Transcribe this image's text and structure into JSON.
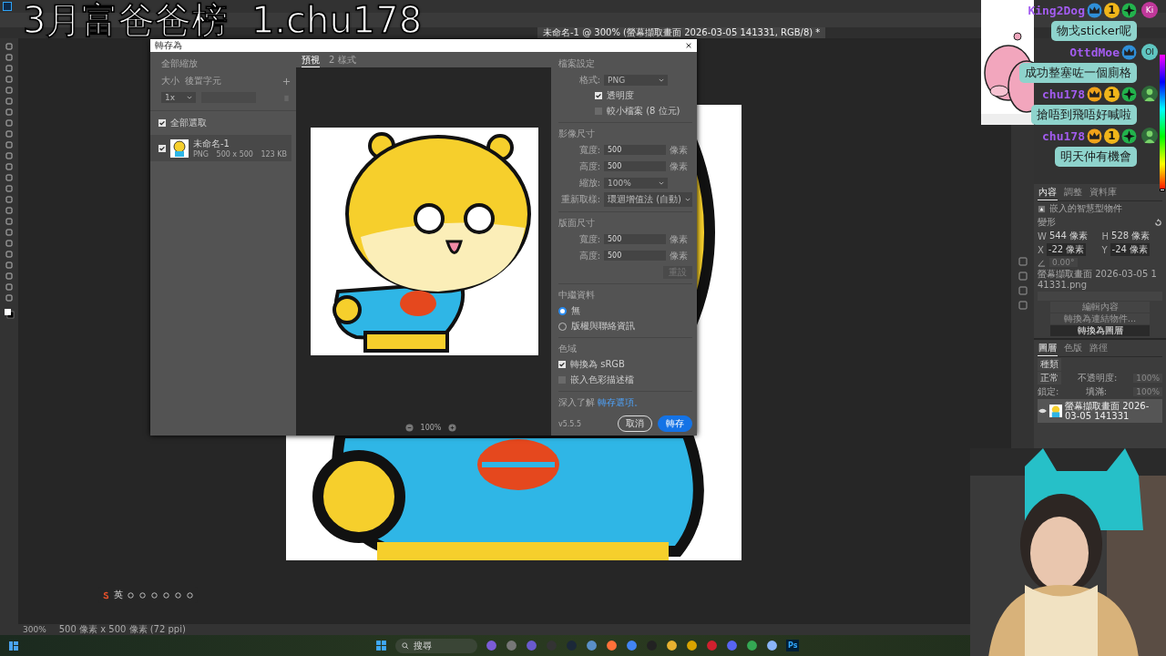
{
  "overlay_title": "3月富爸爸榜  1.chu178",
  "doc_tab": {
    "label": "未命名-1 @ 300% (螢幕擷取畫面 2026-03-05 141331, RGB/8) *",
    "selected": true
  },
  "export_dialog": {
    "title": "轉存為",
    "scale_all": "全部縮放",
    "size_label": "大小",
    "suffix_label": "後置字元",
    "scale": "1x",
    "select_all": {
      "label": "全部選取",
      "checked": true
    },
    "assets": [
      {
        "name": "未命名-1",
        "format": "PNG",
        "dimensions": "500 x 500",
        "file_size": "123 KB",
        "checked": true
      }
    ],
    "tabs": [
      {
        "label": "預視",
        "selected": true
      },
      {
        "label": "2 樣式",
        "selected": false
      }
    ],
    "zoom": "100%",
    "file_settings": {
      "heading": "檔案設定",
      "format_label": "格式:",
      "format": "PNG",
      "options": [
        {
          "label": "透明度",
          "checked": true
        },
        {
          "label": "較小檔案 (8 位元)",
          "checked": false
        }
      ]
    },
    "image_size": {
      "heading": "影像尺寸",
      "fields": [
        {
          "label": "寬度:",
          "value": "500",
          "unit": "像素"
        },
        {
          "label": "高度:",
          "value": "500",
          "unit": "像素"
        }
      ],
      "scale_label": "縮放:",
      "scale": "100%",
      "resample_label": "重新取樣:",
      "resample": "環迴增值法 (自動)"
    },
    "canvas_size": {
      "heading": "版面尺寸",
      "fields": [
        {
          "label": "寬度:",
          "value": "500",
          "unit": "像素"
        },
        {
          "label": "高度:",
          "value": "500",
          "unit": "像素"
        }
      ],
      "reset": {
        "label": "重設",
        "disabled": true
      }
    },
    "metadata": {
      "heading": "中繼資料",
      "options": [
        {
          "label": "無",
          "selected": true
        },
        {
          "label": "版權與聯絡資訊",
          "selected": false
        }
      ]
    },
    "color_space": {
      "heading": "色域",
      "options": [
        {
          "label": "轉換為 sRGB",
          "checked": true
        },
        {
          "label": "嵌入色彩描述檔",
          "checked": false
        }
      ]
    },
    "learn_more": "深入了解",
    "learn_more_link": "轉存選項。",
    "version": "v5.5.5",
    "buttons": [
      {
        "label": "取消",
        "kind": "secondary"
      },
      {
        "label": "轉存",
        "kind": "primary"
      }
    ]
  },
  "chat": [
    {
      "kind": "user",
      "name": "King2Dog",
      "rank_badge": "1",
      "avatar": "Ki",
      "color": "#2f8fd8"
    },
    {
      "kind": "message",
      "text": "物戈sticker呢"
    },
    {
      "kind": "user",
      "name": "OttdMoe",
      "avatar": "OI",
      "color": "#2f8fd8"
    },
    {
      "kind": "message",
      "text": "成功整塞咗一個廁格"
    },
    {
      "kind": "user",
      "name": "chu178",
      "rank_badge": "1",
      "color": "#f0a21a"
    },
    {
      "kind": "message",
      "text": "搶唔到飛唔好喊啦"
    },
    {
      "kind": "user",
      "name": "chu178",
      "rank_badge": "1",
      "color": "#f0a21a"
    },
    {
      "kind": "message",
      "text": "明天仲有機會"
    }
  ],
  "properties_panel": {
    "tabs": [
      {
        "label": "內容",
        "selected": true
      },
      {
        "label": "調整",
        "selected": false
      },
      {
        "label": "資料庫",
        "selected": false
      }
    ],
    "object_type": "嵌入的智慧型物件",
    "section": "變形",
    "transform": [
      {
        "axis": "W",
        "value": "544 像素"
      },
      {
        "axis": "H",
        "value": "528 像素"
      },
      {
        "axis": "X",
        "value": "-22 像素"
      },
      {
        "axis": "Y",
        "value": "-24 像素"
      }
    ],
    "angle": "0.00°",
    "source_file": "螢幕擷取畫面 2026-03-05 141331.png",
    "buttons": [
      "編輯內容",
      "轉換為連結物件...",
      "轉換為圖層"
    ]
  },
  "layers_panel": {
    "tabs": [
      {
        "label": "圖層",
        "selected": true
      },
      {
        "label": "色版",
        "selected": false
      },
      {
        "label": "路徑",
        "selected": false
      }
    ],
    "filter": "種類",
    "blend_mode": "正常",
    "opacity_label": "不透明度:",
    "opacity": "100%",
    "lock_label": "鎖定:",
    "fill_label": "填滿:",
    "fill": "100%",
    "layers": [
      {
        "name": "螢幕擷取畫面 2026-03-05 141331",
        "selected": true
      }
    ]
  },
  "hue_slider": {
    "level": 0
  },
  "status_bar": {
    "zoom": "300%",
    "doc_info": "500 像素 x 500 像素 (72 ppi)"
  },
  "ime_bar": {
    "language": "英"
  },
  "taskbar": {
    "search": "搜尋",
    "active_app_label": "Ps"
  }
}
